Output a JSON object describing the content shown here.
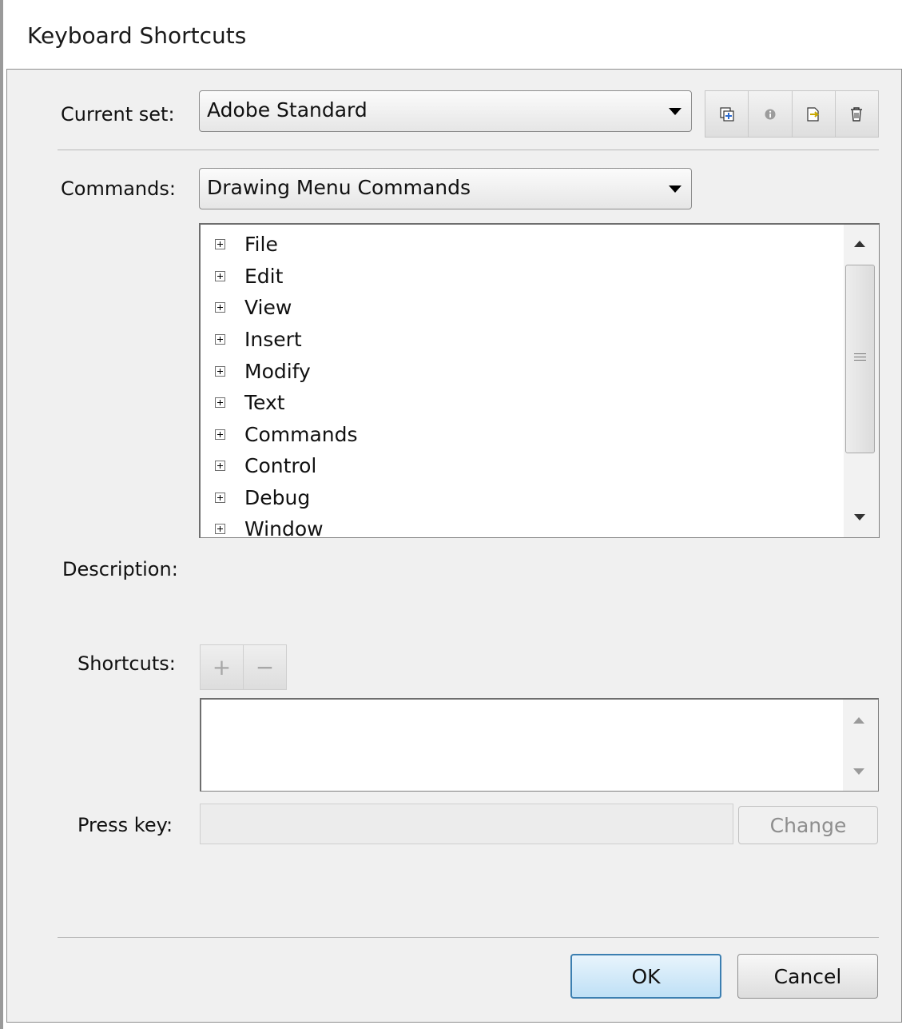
{
  "dialog": {
    "title": "Keyboard Shortcuts"
  },
  "current_set": {
    "label": "Current set:",
    "value": "Adobe Standard",
    "icons": [
      "duplicate-set-icon",
      "info-icon",
      "export-set-icon",
      "delete-set-icon"
    ]
  },
  "commands": {
    "label": "Commands:",
    "value": "Drawing Menu Commands",
    "tree": [
      "File",
      "Edit",
      "View",
      "Insert",
      "Modify",
      "Text",
      "Commands",
      "Control",
      "Debug",
      "Window"
    ]
  },
  "description": {
    "label": "Description:"
  },
  "shortcuts": {
    "label": "Shortcuts:",
    "add": "+",
    "remove": "−"
  },
  "press_key": {
    "label": "Press key:",
    "value": "",
    "change": "Change"
  },
  "buttons": {
    "ok": "OK",
    "cancel": "Cancel"
  },
  "colors": {
    "panel": "#f0f0f0",
    "primary_button": "#bfe0f6",
    "disabled_text": "#8e8e8e"
  }
}
